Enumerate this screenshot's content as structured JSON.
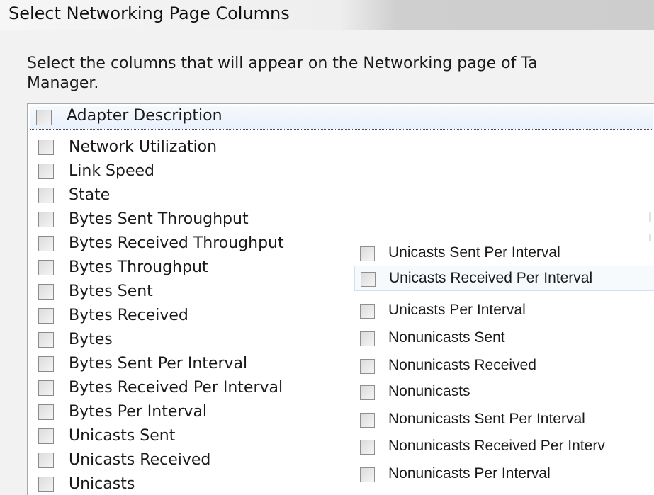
{
  "window": {
    "title": "Select Networking Page Columns"
  },
  "description": {
    "line1": "Select the columns that will appear on the Networking page of Ta",
    "line2": "Manager."
  },
  "columns_list": {
    "items": [
      {
        "label": "Adapter Description",
        "checked": false,
        "focused": true
      },
      {
        "label": "Network Utilization",
        "checked": false
      },
      {
        "label": "Link Speed",
        "checked": false
      },
      {
        "label": "State",
        "checked": false
      },
      {
        "label": "Bytes Sent Throughput",
        "checked": false
      },
      {
        "label": "Bytes Received Throughput",
        "checked": false
      },
      {
        "label": "Bytes Throughput",
        "checked": false
      },
      {
        "label": "Bytes Sent",
        "checked": false
      },
      {
        "label": "Bytes Received",
        "checked": false
      },
      {
        "label": "Bytes",
        "checked": false
      },
      {
        "label": "Bytes Sent Per Interval",
        "checked": false
      },
      {
        "label": "Bytes Received Per Interval",
        "checked": false
      },
      {
        "label": "Bytes Per Interval",
        "checked": false
      },
      {
        "label": "Unicasts Sent",
        "checked": false
      },
      {
        "label": "Unicasts Received",
        "checked": false
      },
      {
        "label": "Unicasts",
        "checked": false
      }
    ]
  },
  "columns_list_2": {
    "items": [
      {
        "label": "Unicasts Sent Per Interval",
        "checked": false
      },
      {
        "label": "Unicasts Received Per Interval",
        "checked": false,
        "selected": true
      },
      {
        "label": "Unicasts Per Interval",
        "checked": false
      },
      {
        "label": "Nonunicasts Sent",
        "checked": false
      },
      {
        "label": "Nonunicasts Received",
        "checked": false
      },
      {
        "label": "Nonunicasts",
        "checked": false
      },
      {
        "label": "Nonunicasts Sent Per Interval",
        "checked": false
      },
      {
        "label": "Nonunicasts Received Per Interv",
        "checked": false
      },
      {
        "label": "Nonunicasts Per Interval",
        "checked": false
      }
    ]
  }
}
